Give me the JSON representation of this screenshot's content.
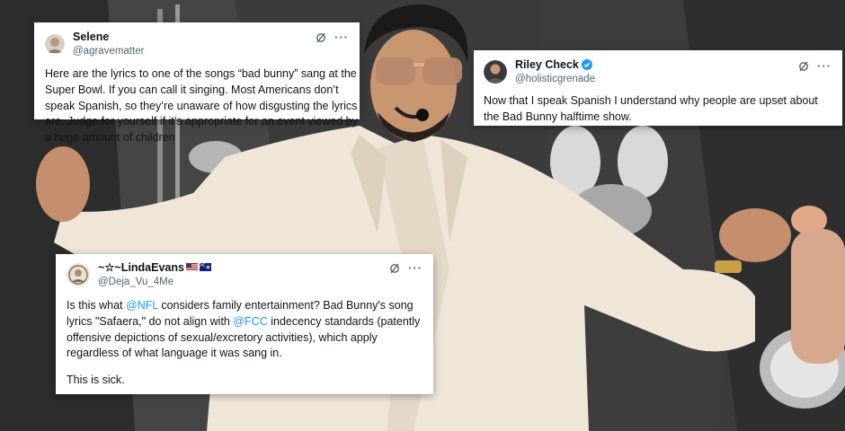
{
  "colors": {
    "link": "#1d9bf0",
    "verified": "#1d9bf0",
    "text": "#0f1419",
    "muted": "#536471",
    "suit": "#efe6d8"
  },
  "tweets": [
    {
      "display_name": "Selene",
      "handle": "@agravematter",
      "verified": false,
      "avatar": "photo-avatar",
      "body": "Here are the lyrics to one of the songs “bad bunny” sang at the Super Bowl. If you can call it singing. Most Americans don’t speak Spanish, so they’re unaware of how disgusting the lyrics are. Judge for yourself if it’s appropriate for an event viewed by a huge amount of children"
    },
    {
      "display_name": "Riley Check",
      "handle": "@holisticgrenade",
      "verified": true,
      "avatar": "photo-avatar",
      "body": "Now that I speak Spanish I understand why people are upset about the Bad Bunny halftime show."
    },
    {
      "display_name": "~☆~LindaEvans",
      "handle": "@Deja_Vu_4Me",
      "verified": false,
      "avatar": "photo-avatar",
      "flags": [
        "us-flag-icon",
        "cayman-flag-icon"
      ],
      "body_parts": {
        "p1_a": "Is this what ",
        "p1_mention1": "@NFL",
        "p1_b": " considers family entertainment? Bad Bunny's song lyrics \"Safaera,\" do not align with ",
        "p1_mention2": "@FCC",
        "p1_c": " indecency standards (patently offensive depictions of sexual/excretory activities), which apply regardless of what language it was sang in.",
        "p2": "This is sick."
      }
    }
  ],
  "icons": {
    "grok": "grok-icon",
    "more": "more-options-icon",
    "more_glyph": "···"
  }
}
